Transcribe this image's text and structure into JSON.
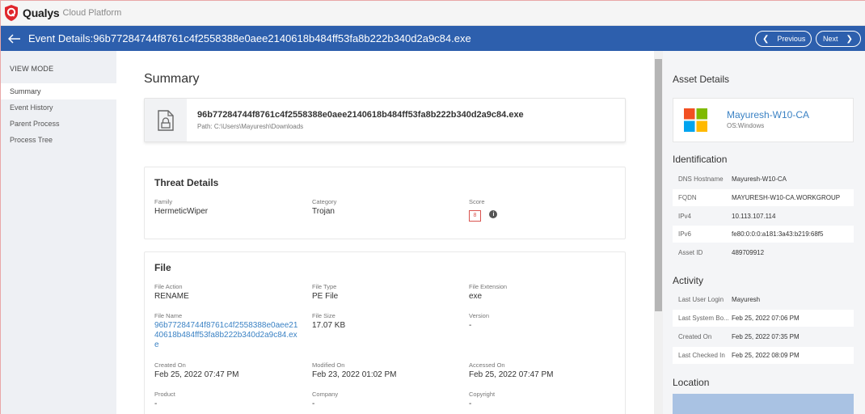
{
  "brand": {
    "name": "Qualys",
    "product": "Cloud Platform"
  },
  "header": {
    "title": "Event Details:96b77284744f8761c4f2558388e0aee2140618b484ff53fa8b222b340d2a9c84.exe",
    "prev_label": "Previous",
    "next_label": "Next"
  },
  "sidebar": {
    "heading": "VIEW MODE",
    "items": [
      {
        "label": "Summary",
        "active": true
      },
      {
        "label": "Event History"
      },
      {
        "label": "Parent Process"
      },
      {
        "label": "Process Tree"
      }
    ]
  },
  "summary": {
    "title": "Summary",
    "file_hash": "96b77284744f8761c4f2558388e0aee2140618b484ff53fa8b222b340d2a9c84.exe",
    "file_path": "Path: C:\\Users\\Mayuresh\\Downloads"
  },
  "threat": {
    "title": "Threat Details",
    "family_label": "Family",
    "family": "HermeticWiper",
    "category_label": "Category",
    "category": "Trojan",
    "score_label": "Score",
    "score": "8"
  },
  "file": {
    "title": "File",
    "action_label": "File Action",
    "action": "RENAME",
    "type_label": "File Type",
    "type": "PE File",
    "ext_label": "File Extension",
    "ext": "exe",
    "name_label": "File Name",
    "name": "96b77284744f8761c4f2558388e0aee2140618b484ff53fa8b222b340d2a9c84.exe",
    "size_label": "File Size",
    "size": "17.07 KB",
    "version_label": "Version",
    "version": "-",
    "created_label": "Created On",
    "created": "Feb 25, 2022 07:47 PM",
    "modified_label": "Modified On",
    "modified": "Feb 23, 2022 01:02 PM",
    "accessed_label": "Accessed On",
    "accessed": "Feb 25, 2022 07:47 PM",
    "product_label": "Product",
    "product": "-",
    "company_label": "Company",
    "company": "-",
    "copyright_label": "Copyright",
    "copyright": "-"
  },
  "asset": {
    "heading": "Asset Details",
    "name": "Mayuresh-W10-CA",
    "os": "OS:Windows",
    "identification_heading": "Identification",
    "identification": [
      {
        "key": "DNS Hostname",
        "value": "Mayuresh-W10-CA"
      },
      {
        "key": "FQDN",
        "value": "MAYURESH-W10-CA.WORKGROUP"
      },
      {
        "key": "IPv4",
        "value": "10.113.107.114"
      },
      {
        "key": "IPv6",
        "value": "fe80:0:0:0:a181:3a43:b219:68f5"
      },
      {
        "key": "Asset ID",
        "value": "489709912"
      }
    ],
    "activity_heading": "Activity",
    "activity": [
      {
        "key": "Last User Login",
        "value": "Mayuresh"
      },
      {
        "key": "Last System Bo...",
        "value": "Feb 25, 2022 07:06 PM"
      },
      {
        "key": "Created On",
        "value": "Feb 25, 2022 07:35 PM"
      },
      {
        "key": "Last Checked In",
        "value": "Feb 25, 2022 08:09 PM"
      }
    ],
    "location_heading": "Location"
  },
  "colors": {
    "header_bg": "#2d5fad",
    "link": "#3b82c4",
    "score_border": "#d9534f",
    "win_red": "#f25022",
    "win_green": "#7fba00",
    "win_blue": "#00a4ef",
    "win_yellow": "#ffb900"
  }
}
